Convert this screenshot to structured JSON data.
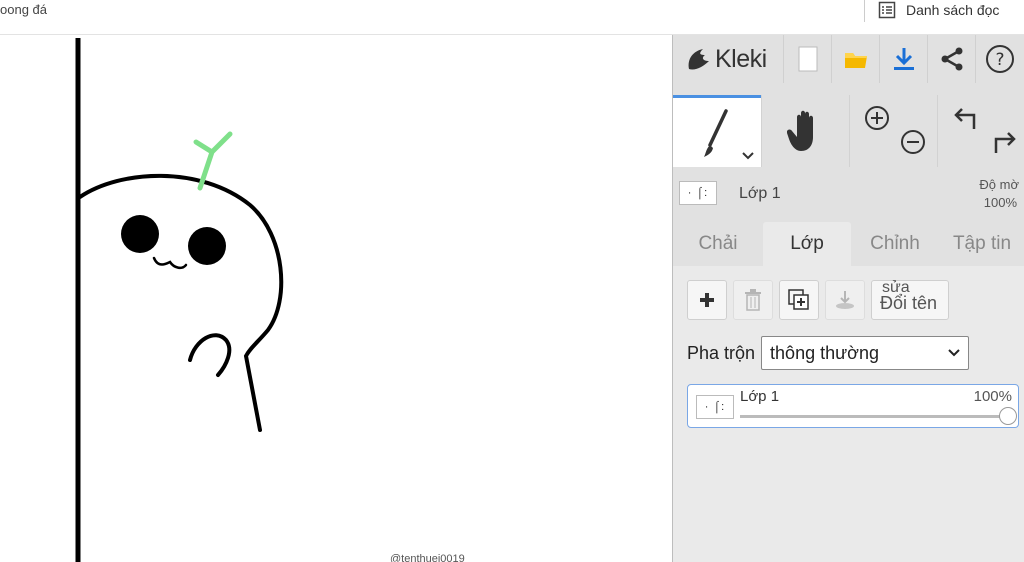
{
  "bookmarks": {
    "left_item": "oong đá",
    "reading_list": "Danh sách đọc"
  },
  "canvas": {
    "watermark": "@tenthuei0019"
  },
  "sidebar": {
    "logo": "Kleki",
    "layer_info": {
      "thumb": "· ⌠:",
      "name": "Lớp 1",
      "opacity_label": "Độ mờ",
      "opacity_value": "100%"
    },
    "tabs": [
      {
        "label": "Chải"
      },
      {
        "label": "Lớp"
      },
      {
        "label": "Chỉnh"
      },
      {
        "label": "Tập tin"
      }
    ],
    "layer_buttons": {
      "rename_top": "sửa",
      "rename": "Đổi tên"
    },
    "blend": {
      "label": "Pha trộn",
      "value": "thông thường"
    },
    "layer_item": {
      "thumb": "· ⌠:",
      "name": "Lớp 1",
      "opacity": "100%",
      "opacity_fraction": 1.0
    }
  },
  "colors": {
    "accent": "#4a90e2",
    "download": "#1a6fd6",
    "folder": "#f5b800",
    "sprout": "#7fe08a"
  }
}
